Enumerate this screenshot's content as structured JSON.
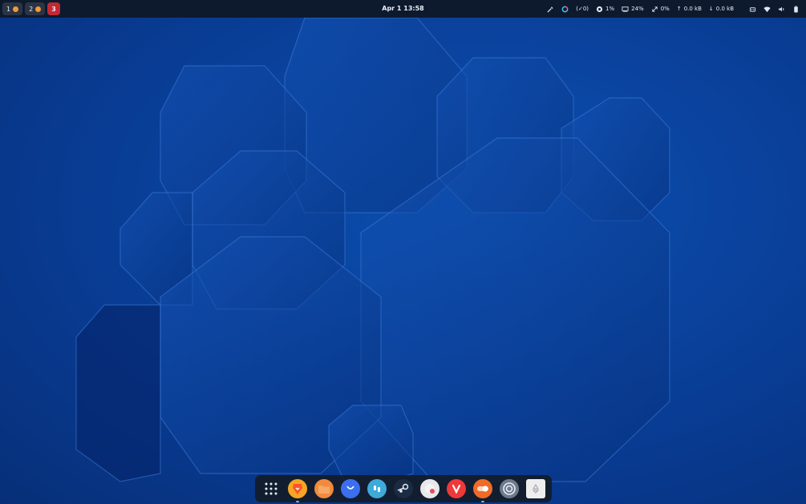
{
  "topbar": {
    "workspaces": [
      {
        "label": "1",
        "active": false,
        "has_app": true
      },
      {
        "label": "2",
        "active": false,
        "has_app": true
      },
      {
        "label": "3",
        "active": true,
        "has_app": false
      }
    ],
    "clock": "Apr 1  13:58",
    "tray": {
      "color_picker_icon": "eyedropper-icon",
      "gauge_icon": "color-circle-icon",
      "updates": "(✓0)",
      "cpu": "1%",
      "memory": "24%",
      "swap": "0%",
      "upload": "0.0 kB",
      "download": "0.0 kB"
    }
  },
  "dock": {
    "apps": [
      {
        "name": "app-grid",
        "icon": "grid-icon",
        "color": "#1a2333"
      },
      {
        "name": "brave",
        "icon": "brave-icon",
        "color": "#f5a623",
        "running": true
      },
      {
        "name": "files",
        "icon": "folder-icon",
        "color": "#f28a3c"
      },
      {
        "name": "software",
        "icon": "bag-icon",
        "color": "#3b6ff0"
      },
      {
        "name": "flathub",
        "icon": "quote-icon",
        "color": "#3fa9d8"
      },
      {
        "name": "steam",
        "icon": "steam-icon",
        "color": "#1b2b44"
      },
      {
        "name": "warehouse",
        "icon": "mask-icon",
        "color": "#e8e8ea"
      },
      {
        "name": "vivaldi",
        "icon": "vivaldi-icon",
        "color": "#ef3939"
      },
      {
        "name": "toggle",
        "icon": "switch-icon",
        "color": "#f06a28",
        "running": true
      },
      {
        "name": "settings",
        "icon": "target-icon",
        "color": "#6e7a8c"
      },
      {
        "name": "trash",
        "icon": "trash-icon",
        "color": "#eeeeee"
      }
    ]
  }
}
